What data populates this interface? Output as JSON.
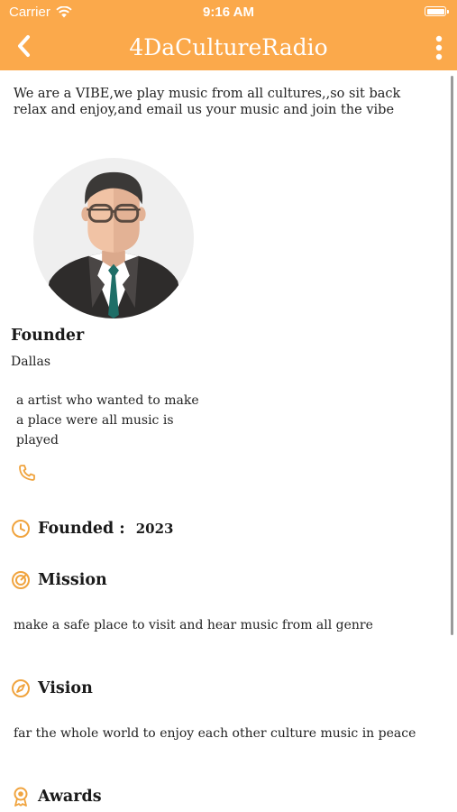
{
  "status": {
    "carrier": "Carrier",
    "time": "9:16 AM"
  },
  "nav": {
    "title": "4DaCultureRadio"
  },
  "about": "We are a VIBE,we play music from all cultures,,so sit back relax and enjoy,and email us your music and join the vibe",
  "member": {
    "name": "Founder",
    "location": "Dallas",
    "bio": "a artist who wanted to make a place were all music is played"
  },
  "founded": {
    "label": "Founded :",
    "year": "2023"
  },
  "mission": {
    "label": "Mission",
    "text": "make a safe place to visit and hear music from all genre"
  },
  "vision": {
    "label": "Vision",
    "text": "far the whole world to enjoy each other culture music in peace"
  },
  "awards": {
    "label": "Awards"
  },
  "colors": {
    "accent": "#fba94b",
    "text": "#222222",
    "background": "#ffffff"
  },
  "icons": [
    "wifi-icon",
    "battery-icon",
    "back-icon",
    "more-icon",
    "phone-icon",
    "clock-icon",
    "target-icon",
    "compass-icon",
    "award-icon"
  ]
}
